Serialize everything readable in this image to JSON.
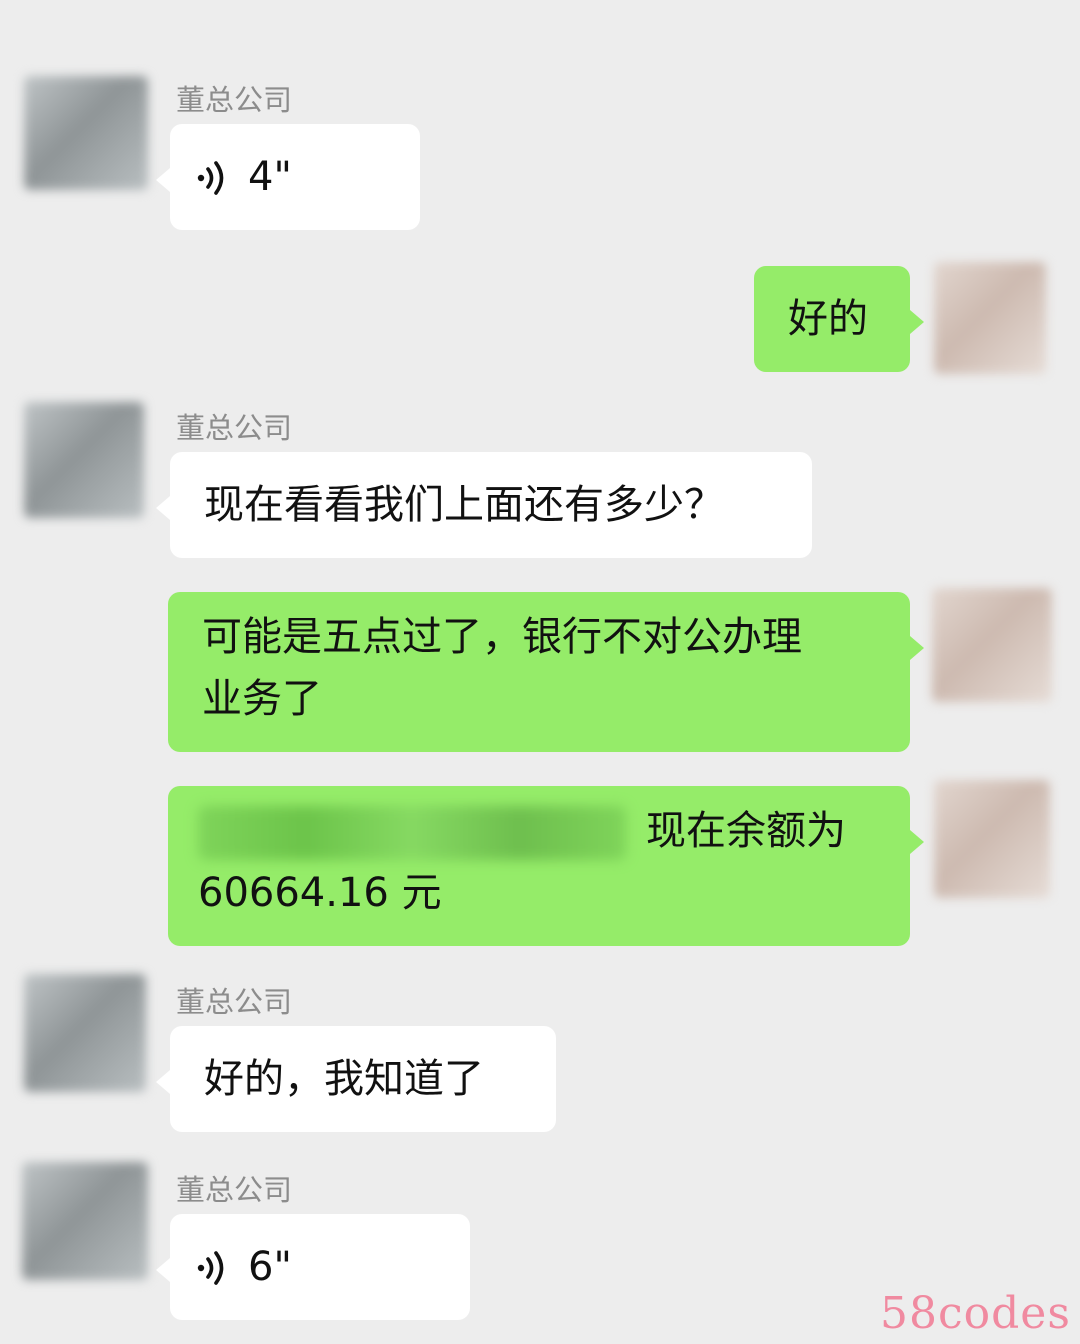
{
  "messages": [
    {
      "type": "voice",
      "side": "left",
      "sender": "董总公司",
      "duration": "4\""
    },
    {
      "type": "text",
      "side": "right",
      "text": "好的"
    },
    {
      "type": "text",
      "side": "left",
      "sender": "董总公司",
      "text": "现在看看我们上面还有多少？"
    },
    {
      "type": "text",
      "side": "right",
      "line1": "可能是五点过了，银行不对公办理",
      "line2": "业务了"
    },
    {
      "type": "text",
      "side": "right",
      "line1_visible": "现在余额为",
      "line2": "60664.16 元"
    },
    {
      "type": "text",
      "side": "left",
      "sender": "董总公司",
      "text": "好的，我知道了"
    },
    {
      "type": "voice",
      "side": "left",
      "sender": "董总公司",
      "duration": "6\""
    }
  ],
  "watermark": "58codes",
  "colors": {
    "background": "#ededed",
    "outgoing_bubble": "#95ec69",
    "incoming_bubble": "#ffffff",
    "watermark": "#f08aa0"
  },
  "icons": {
    "voice": "voice-wave-icon"
  }
}
